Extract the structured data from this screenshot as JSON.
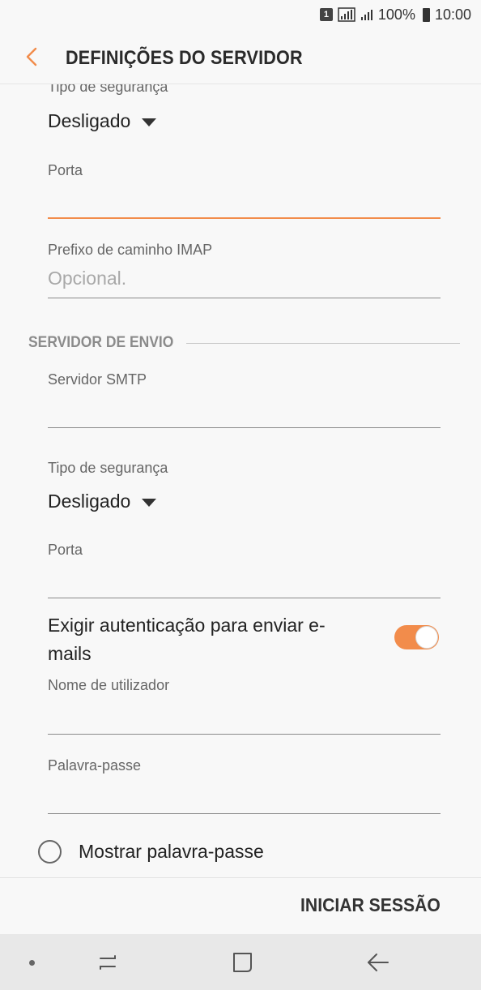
{
  "status_bar": {
    "sim": "1",
    "battery": "100%",
    "time": "10:00"
  },
  "header": {
    "title": "DEFINIÇÕES DO SERVIDOR"
  },
  "incoming": {
    "security_label": "Tipo de segurança",
    "security_value": "Desligado",
    "port_label": "Porta",
    "port_value": "",
    "imap_prefix_label": "Prefixo de caminho IMAP",
    "imap_prefix_placeholder": "Opcional."
  },
  "outgoing": {
    "section_title": "SERVIDOR DE ENVIO",
    "smtp_label": "Servidor SMTP",
    "smtp_value": "",
    "security_label": "Tipo de segurança",
    "security_value": "Desligado",
    "port_label": "Porta",
    "port_value": "",
    "require_auth_label": "Exigir autenticação para enviar e-mails",
    "require_auth_on": true,
    "username_label": "Nome de utilizador",
    "username_value": "",
    "password_label": "Palavra-passe",
    "password_value": "",
    "show_password_label": "Mostrar palavra-passe",
    "show_password_checked": false
  },
  "actions": {
    "login_label": "INICIAR SESSÃO"
  },
  "colors": {
    "accent": "#f28c4b"
  },
  "icons": {
    "back": "chevron-left-icon",
    "nav_recent": "recent-apps-icon",
    "nav_home": "home-icon",
    "nav_back": "back-arrow-icon"
  }
}
